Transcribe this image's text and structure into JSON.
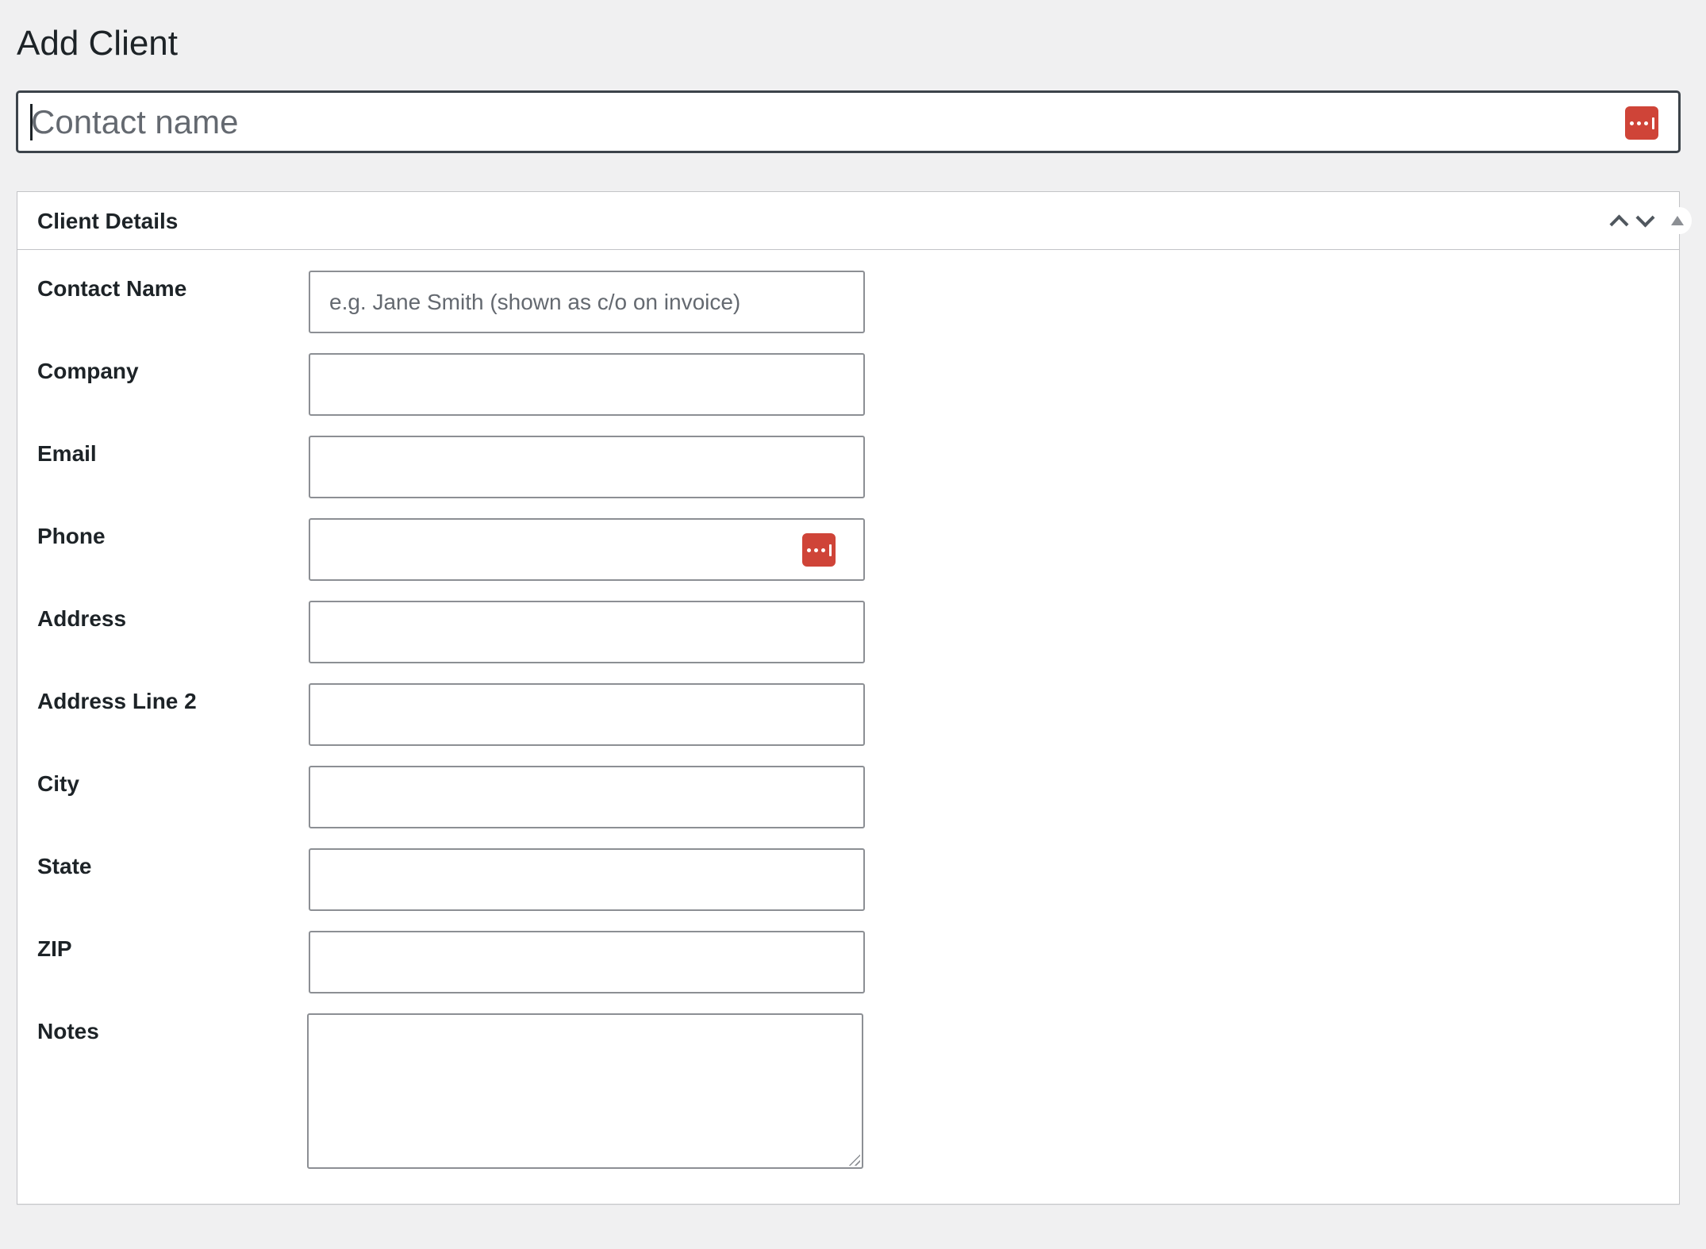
{
  "page": {
    "title": "Add Client"
  },
  "title_field": {
    "placeholder": "Contact name",
    "value": "",
    "icon": "password-manager-icon"
  },
  "metabox": {
    "title": "Client Details",
    "controls": [
      "move-up",
      "move-down",
      "toggle-panel"
    ],
    "fields": [
      {
        "label": "Contact Name",
        "placeholder": "e.g. Jane Smith (shown as c/o on invoice)",
        "value": ""
      },
      {
        "label": "Company",
        "placeholder": "",
        "value": ""
      },
      {
        "label": "Email",
        "placeholder": "",
        "value": ""
      },
      {
        "label": "Phone",
        "placeholder": "",
        "value": "",
        "icon": "password-manager-icon"
      },
      {
        "label": "Address",
        "placeholder": "",
        "value": ""
      },
      {
        "label": "Address Line 2",
        "placeholder": "",
        "value": ""
      },
      {
        "label": "City",
        "placeholder": "",
        "value": ""
      },
      {
        "label": "State",
        "placeholder": "",
        "value": ""
      },
      {
        "label": "ZIP",
        "placeholder": "",
        "value": ""
      }
    ],
    "notes": {
      "label": "Notes",
      "value": ""
    }
  },
  "colors": {
    "background": "#f0f0f1",
    "panel": "#ffffff",
    "text": "#1d2327",
    "placeholder": "#646970",
    "input_border": "#8c8f94",
    "focus_border": "#3c434a",
    "password_manager_accent": "#cf4438"
  }
}
